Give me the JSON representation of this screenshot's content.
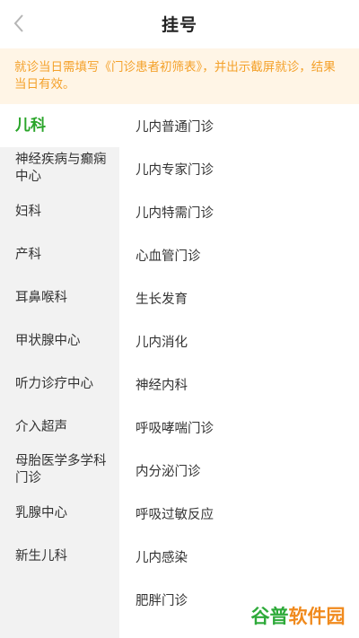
{
  "header": {
    "title": "挂号",
    "back_icon": "chevron-left-icon"
  },
  "notice": {
    "text": "就诊当日需填写《门诊患者初筛表》，并出示截屏就诊，结果当日有效。"
  },
  "departments": [
    {
      "label": "儿科",
      "active": true
    },
    {
      "label": "神经疾病与癫痫中心",
      "active": false
    },
    {
      "label": "妇科",
      "active": false
    },
    {
      "label": "产科",
      "active": false
    },
    {
      "label": "耳鼻喉科",
      "active": false
    },
    {
      "label": "甲状腺中心",
      "active": false
    },
    {
      "label": "听力诊疗中心",
      "active": false
    },
    {
      "label": "介入超声",
      "active": false
    },
    {
      "label": "母胎医学多学科门诊",
      "active": false
    },
    {
      "label": "乳腺中心",
      "active": false
    },
    {
      "label": "新生儿科",
      "active": false
    }
  ],
  "clinics": [
    "儿内普通门诊",
    "儿内专家门诊",
    "儿内特需门诊",
    "心血管门诊",
    "生长发育",
    "儿内消化",
    "神经内科",
    "呼吸哮喘门诊",
    "内分泌门诊",
    "呼吸过敏反应",
    "儿内感染",
    "肥胖门诊"
  ],
  "watermark": {
    "part1": "谷普",
    "part2": "软件园"
  },
  "colors": {
    "accent": "#2aa52a",
    "notice_text": "#f4a12a",
    "notice_bg": "#fff5e6",
    "sidebar_bg": "#f2f2f2"
  }
}
